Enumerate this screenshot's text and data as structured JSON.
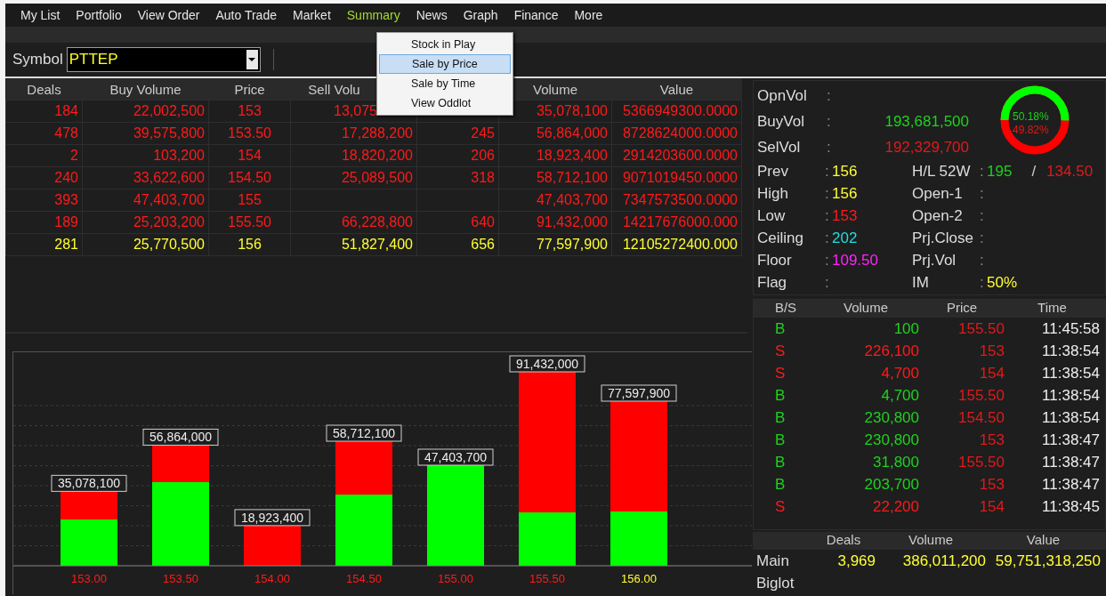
{
  "menu": [
    {
      "label": "My List",
      "selected": false
    },
    {
      "label": "Portfolio",
      "selected": false
    },
    {
      "label": "View Order",
      "selected": false
    },
    {
      "label": "Auto Trade",
      "selected": false
    },
    {
      "label": "Market",
      "selected": false
    },
    {
      "label": "Summary",
      "selected": true
    },
    {
      "label": "News",
      "selected": false
    },
    {
      "label": "Graph",
      "selected": false
    },
    {
      "label": "Finance",
      "selected": false
    },
    {
      "label": "More",
      "selected": false
    }
  ],
  "dropdown": [
    {
      "label": "Stock in Play",
      "selected": false
    },
    {
      "label": "Sale by Price",
      "selected": true
    },
    {
      "label": "Sale by Time",
      "selected": false
    },
    {
      "label": "View Oddlot",
      "selected": false
    }
  ],
  "symbol": {
    "label": "Symbol",
    "value": "PTTEP"
  },
  "table": {
    "columns": [
      {
        "label": "Deals",
        "covered": false
      },
      {
        "label": "Buy Volume",
        "covered": false
      },
      {
        "label": "Price",
        "covered": false
      },
      {
        "label": "Sell Volu",
        "covered": true
      },
      null,
      {
        "label": "Volume",
        "covered": false
      },
      {
        "label": "Value",
        "covered": false
      }
    ],
    "rows": [
      {
        "color": "#ff1a1a",
        "cells": [
          "184",
          "22,002,500",
          "153",
          {
            "text": "13,075",
            "covered": true
          },
          null,
          "35,078,100",
          "5366949300.0000"
        ]
      },
      {
        "color": "#ff1a1a",
        "cells": [
          "478",
          "39,575,800",
          "153.50",
          "17,288,200",
          "245",
          "56,864,000",
          "8728624000.0000"
        ]
      },
      {
        "color": "#ff1a1a",
        "cells": [
          "2",
          "103,200",
          "154",
          "18,820,200",
          "206",
          "18,923,400",
          "2914203600.0000"
        ]
      },
      {
        "color": "#ff1a1a",
        "cells": [
          "240",
          "33,622,600",
          "154.50",
          "25,089,500",
          "318",
          "58,712,100",
          "9071019450.0000"
        ]
      },
      {
        "color": "#ff1a1a",
        "cells": [
          "393",
          "47,403,700",
          "155",
          null,
          null,
          "47,403,700",
          "7347573500.0000"
        ]
      },
      {
        "color": "#ff1a1a",
        "cells": [
          "189",
          "25,203,200",
          "155.50",
          "66,228,800",
          "640",
          "91,432,000",
          "14217676000.000"
        ]
      },
      {
        "color": "#ffff33",
        "cells": [
          "281",
          "25,770,500",
          "156",
          "51,827,400",
          "656",
          "77,597,900",
          "12105272400.000"
        ]
      }
    ]
  },
  "chart": {
    "chart_data": {
      "type": "bar",
      "categories": [
        "153.00",
        "153.50",
        "154.00",
        "154.50",
        "155.00",
        "155.50",
        "156.00"
      ],
      "values": [
        35078100,
        56864000,
        18923400,
        58712100,
        47403700,
        91432000,
        77597900
      ],
      "value_labels": [
        "35,078,100",
        "56,864,000",
        "18,923,400",
        "58,712,100",
        "47,403,700",
        "91,432,000",
        "77,597,900"
      ]
    }
  },
  "info": {
    "opnvol": {
      "label": "OpnVol",
      "sep": ":"
    },
    "buyvol": {
      "label": "BuyVol",
      "sep": ":",
      "value": "193,681,500"
    },
    "selvol": {
      "label": "SelVol",
      "sep": ":",
      "value": "192,329,700"
    },
    "gauge": {
      "buy_label": "50.18%",
      "sell_label": "49.82%"
    },
    "left": [
      {
        "label": "Prev",
        "sep": ":",
        "value": "156",
        "color": "#ffff33"
      },
      {
        "label": "High",
        "sep": ":",
        "value": "156",
        "color": "#ffff33"
      },
      {
        "label": "Low",
        "sep": ":",
        "value": "153",
        "color": "#ff1a1a"
      },
      {
        "label": "Ceiling",
        "sep": ":",
        "value": "202",
        "color": "#22dddd"
      },
      {
        "label": "Floor",
        "sep": ":",
        "value": "109.50",
        "color": "#ff22ff"
      },
      {
        "label": "Flag",
        "sep": ":"
      }
    ],
    "right": [
      {
        "label": "H/L 52W",
        "sep": ":",
        "value": "195",
        "value2": "/",
        "value3": "134.50"
      },
      {
        "label": "Open-1",
        "sep": ":"
      },
      {
        "label": "Open-2",
        "sep": ":"
      },
      {
        "label": "Prj.Close",
        "sep": ":"
      },
      {
        "label": "Prj.Vol",
        "sep": ":"
      },
      {
        "label": "IM",
        "sep": ":",
        "value": "50%"
      }
    ]
  },
  "trades": {
    "columns": [
      "B/S",
      "Volume",
      "Price",
      "Time"
    ],
    "rows": [
      {
        "side": "B",
        "volume": "100",
        "price": "155.50",
        "time": "11:45:58"
      },
      {
        "side": "S",
        "volume": "226,100",
        "price": "153",
        "time": "11:38:54"
      },
      {
        "side": "S",
        "volume": "4,700",
        "price": "154",
        "time": "11:38:54"
      },
      {
        "side": "B",
        "volume": "4,700",
        "price": "155.50",
        "time": "11:38:54"
      },
      {
        "side": "B",
        "volume": "230,800",
        "price": "154.50",
        "time": "11:38:54"
      },
      {
        "side": "B",
        "volume": "230,800",
        "price": "153",
        "time": "11:38:47"
      },
      {
        "side": "B",
        "volume": "31,800",
        "price": "155.50",
        "time": "11:38:47"
      },
      {
        "side": "B",
        "volume": "203,700",
        "price": "153",
        "time": "11:38:47"
      },
      {
        "side": "S",
        "volume": "22,200",
        "price": "154",
        "time": "11:38:45"
      }
    ]
  },
  "totals": {
    "columns": [
      "Deals",
      "Volume",
      "Value"
    ],
    "rows": [
      {
        "label": "Main",
        "cells": [
          "3,969",
          "386,011,200",
          "59,751,318,250"
        ]
      },
      {
        "label": "Biglot"
      }
    ]
  }
}
